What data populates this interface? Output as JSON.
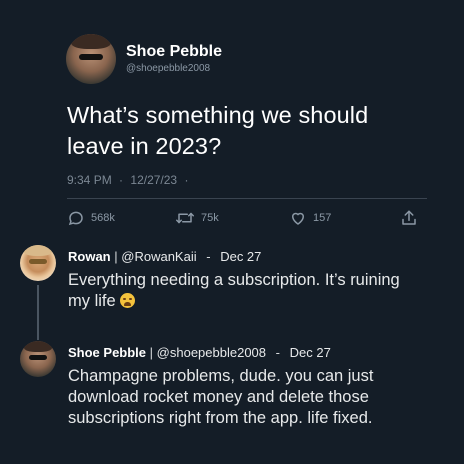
{
  "tweet": {
    "author": {
      "display_name": "Shoe Pebble",
      "handle": "@shoepebble2008"
    },
    "text_line1": "What’s something we should",
    "text_line2": "leave in 2023?",
    "time": "9:34 PM",
    "dot1": "·",
    "date": "12/27/23",
    "dot2": "·",
    "stats": {
      "replies": "568k",
      "retweets": "75k",
      "likes": "157"
    }
  },
  "replies": [
    {
      "name": "Rowan",
      "separator": "|",
      "handle": "@RowanKaii",
      "dash": "-",
      "date": "Dec 27",
      "text_line1": "Everything needing a subscription. It’s ruining",
      "text_line2": "my life",
      "emoji": "tired-face-emoji"
    },
    {
      "name": "Shoe Pebble",
      "separator": "|",
      "handle": "@shoepebble2008",
      "dash": "-",
      "date": "Dec 27",
      "text_line1": "Champagne problems, dude. you can just",
      "text_line2": "download rocket money and delete those",
      "text_line3": "subscriptions right from the app. life fixed."
    }
  ],
  "colors": {
    "background": "#141d27",
    "text": "#ffffff",
    "muted": "#8b98a5",
    "divider": "#3a4450"
  }
}
